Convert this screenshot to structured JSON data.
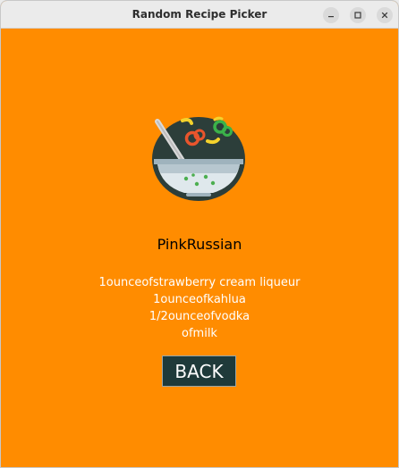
{
  "window": {
    "title": "Random Recipe Picker",
    "controls": {
      "minimize_icon": "minimize-icon",
      "maximize_icon": "maximize-icon",
      "close_icon": "close-icon"
    }
  },
  "colors": {
    "background": "#ff8c00",
    "titlebar": "#ebebeb",
    "button_bg": "#1f3a3a",
    "ingredient_text": "#ffffff",
    "name_text": "#000000"
  },
  "logo": {
    "icon": "salad-bowl-icon"
  },
  "recipe": {
    "name": "PinkRussian",
    "ingredients": [
      "1ounceofstrawberry cream liqueur",
      "1ounceofkahlua",
      "1/2ounceofvodka",
      "ofmilk"
    ]
  },
  "actions": {
    "back_label": "BACK"
  }
}
